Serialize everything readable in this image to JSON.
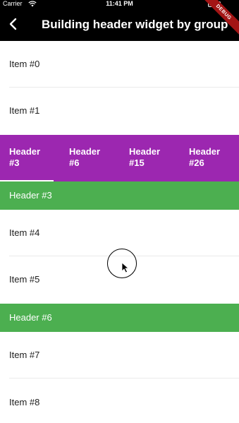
{
  "status_bar": {
    "carrier": "Carrier",
    "time": "11:41 PM",
    "wifi_icon": "wifi-icon",
    "battery_icon": "battery-icon",
    "battery_level": 0.9
  },
  "app_bar": {
    "back_icon": "back-arrow-icon",
    "title": "Building header widget by group"
  },
  "debug_banner": "DEBUG",
  "items_top": [
    {
      "label": "Item #0"
    },
    {
      "label": "Item #1"
    }
  ],
  "tabs": [
    {
      "label": "Header #3",
      "selected": true
    },
    {
      "label": "Header #6",
      "selected": false
    },
    {
      "label": "Header #15",
      "selected": false
    },
    {
      "label": "Header #26",
      "selected": false
    }
  ],
  "group_3": {
    "header": "Header #3",
    "items": [
      {
        "label": "Item #4"
      },
      {
        "label": "Item #5"
      }
    ]
  },
  "group_6": {
    "header": "Header #6",
    "items": [
      {
        "label": "Item #7"
      },
      {
        "label": "Item #8"
      }
    ]
  },
  "colors": {
    "app_bar": "#000000",
    "tab_bar": "#9c27b0",
    "group_header": "#4caf50",
    "debug_banner": "#a31515"
  }
}
